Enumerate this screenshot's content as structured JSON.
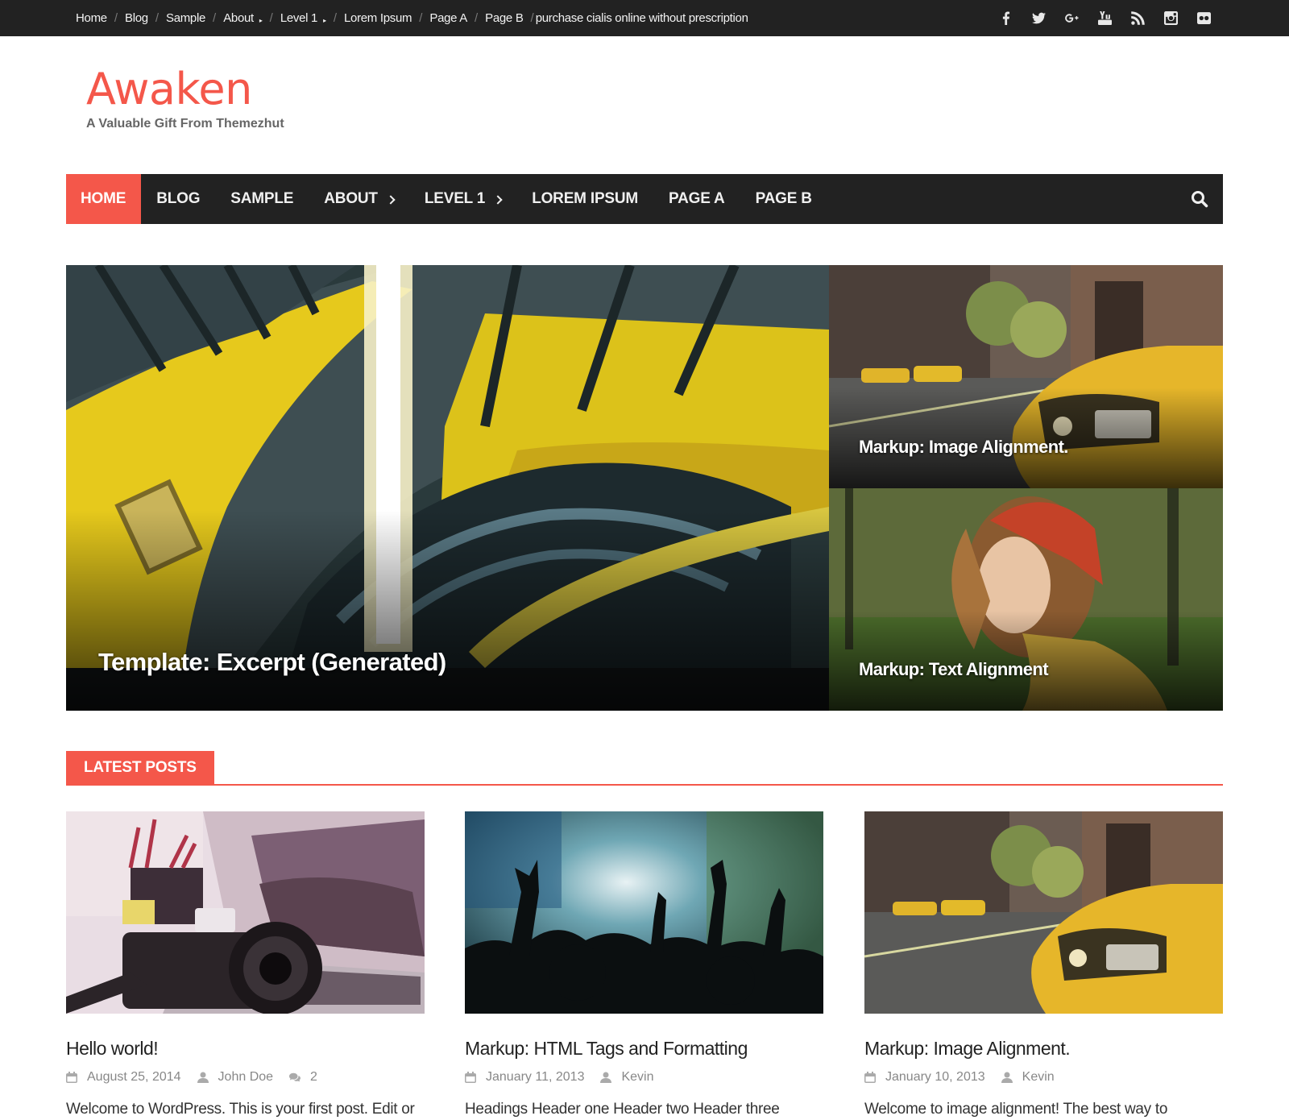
{
  "topbar": {
    "breadcrumbs": [
      {
        "label": "Home"
      },
      {
        "label": "Blog"
      },
      {
        "label": "Sample"
      },
      {
        "label": "About",
        "has_submenu": true
      },
      {
        "label": "Level 1",
        "has_submenu": true
      },
      {
        "label": "Lorem Ipsum"
      },
      {
        "label": "Page A"
      },
      {
        "label": "Page B"
      },
      {
        "label": "purchase cialis online without prescription"
      }
    ],
    "social_icons": [
      "facebook-icon",
      "twitter-icon",
      "google-plus-icon",
      "youtube-icon",
      "rss-icon",
      "instagram-icon",
      "flickr-icon"
    ]
  },
  "branding": {
    "title": "Awaken",
    "description": "A Valuable Gift From Themezhut",
    "accent_color": "#f4574a"
  },
  "nav": {
    "items": [
      {
        "label": "Home",
        "active": true
      },
      {
        "label": "Blog"
      },
      {
        "label": "Sample"
      },
      {
        "label": "About",
        "has_submenu": true
      },
      {
        "label": "Level 1",
        "has_submenu": true
      },
      {
        "label": "Lorem Ipsum"
      },
      {
        "label": "Page A"
      },
      {
        "label": "Page B"
      }
    ],
    "search_icon": "search-icon"
  },
  "featured": {
    "main": {
      "title": "Template: Excerpt (Generated)"
    },
    "side": [
      {
        "title": "Markup: Image Alignment."
      },
      {
        "title": "Markup: Text Alignment"
      }
    ]
  },
  "latest": {
    "heading": "Latest Posts",
    "posts": [
      {
        "title": "Hello world!",
        "date": "August 25, 2014",
        "author": "John Doe",
        "comments": "2",
        "excerpt": "Welcome to WordPress. This is your first post. Edit or"
      },
      {
        "title": "Markup: HTML Tags and Formatting",
        "date": "January 11, 2013",
        "author": "Kevin",
        "excerpt": "Headings Header one Header two Header three"
      },
      {
        "title": "Markup: Image Alignment.",
        "date": "January 10, 2013",
        "author": "Kevin",
        "excerpt": "Welcome to image alignment! The best way to"
      }
    ]
  }
}
